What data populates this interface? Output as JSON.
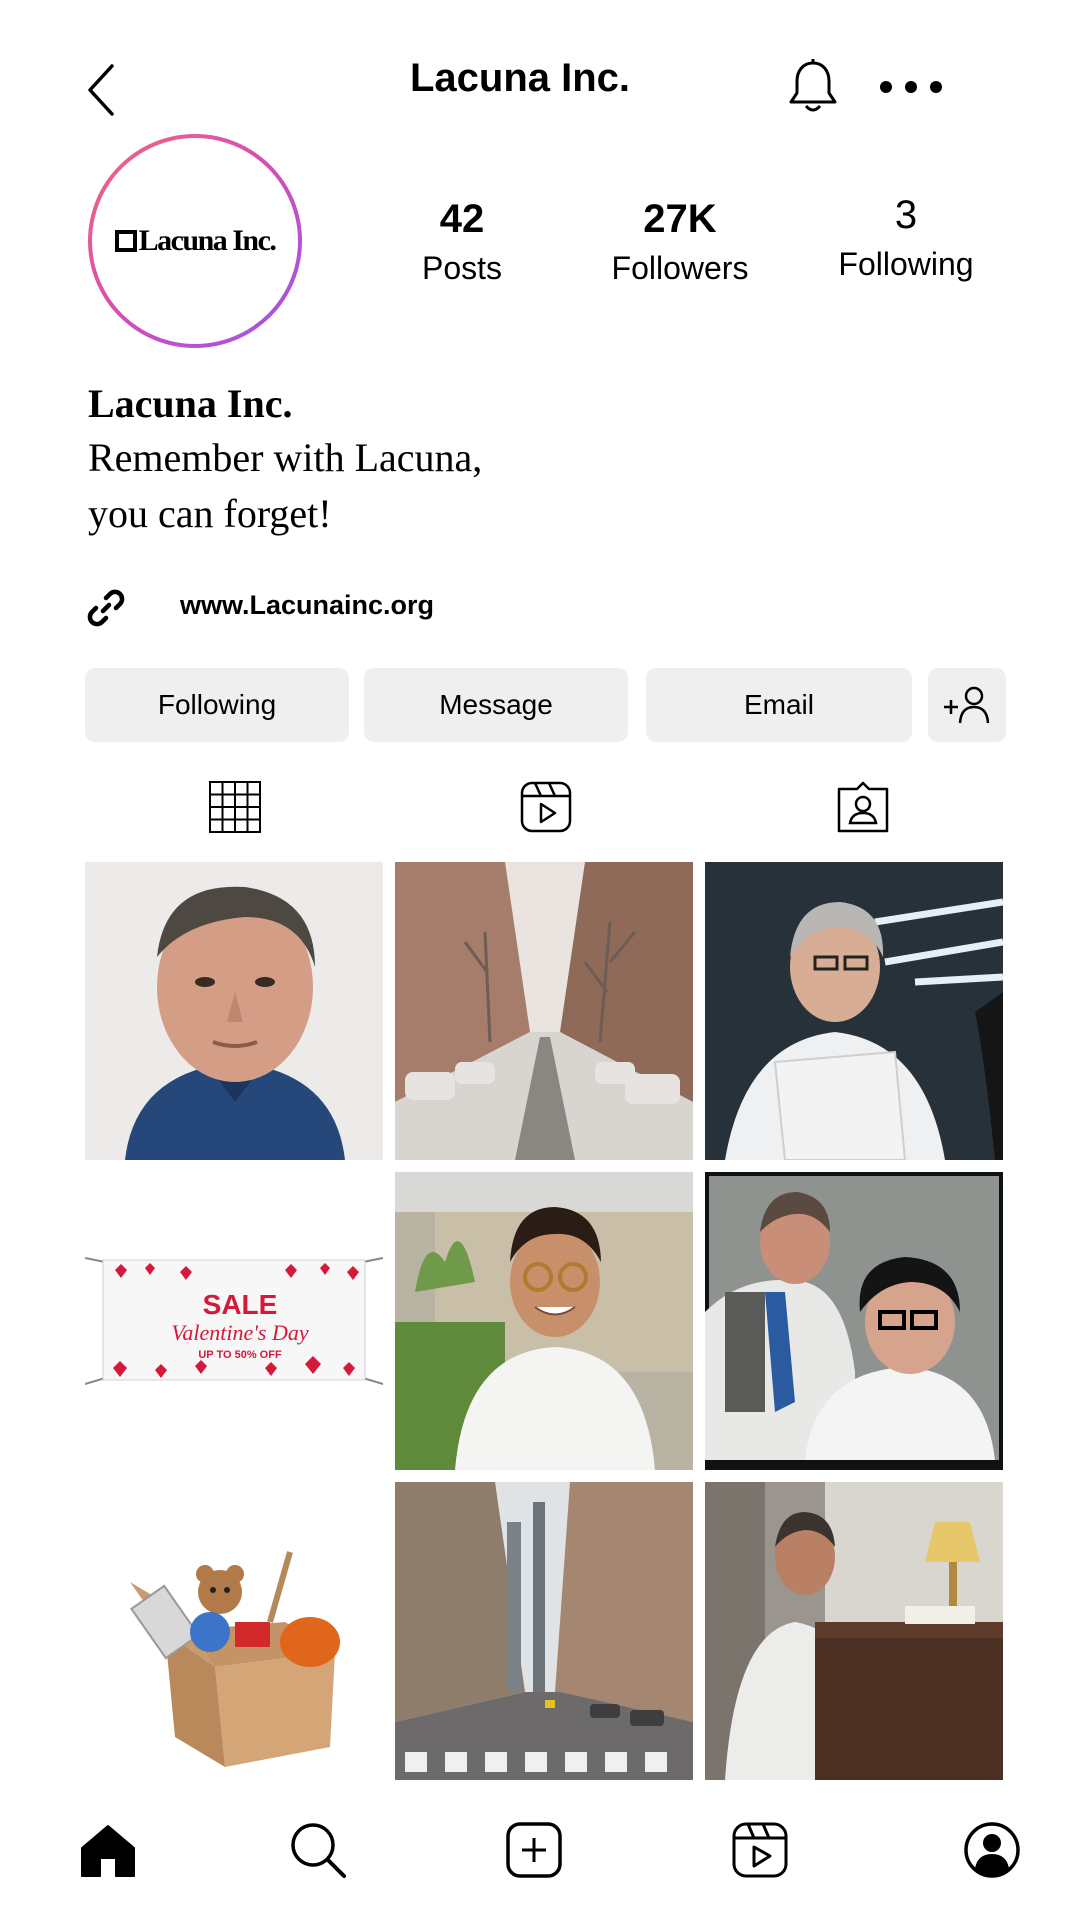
{
  "header": {
    "title": "Lacuna Inc."
  },
  "profile": {
    "avatar_text": "Lacuna Inc.",
    "stats": [
      {
        "value": "42",
        "label": "Posts"
      },
      {
        "value": "27K",
        "label": "Followers"
      },
      {
        "value": "3",
        "label": "Following"
      }
    ],
    "bio_name": "Lacuna Inc.",
    "bio_lines": [
      "Remember with Lacuna,",
      "you can forget!"
    ],
    "website": "www.Lacunainc.org"
  },
  "actions": {
    "following": "Following",
    "message": "Message",
    "email": "Email"
  },
  "grid": {
    "banner": {
      "sale": "SALE",
      "title": "Valentine's Day",
      "sub": "UP TO 50% OFF"
    }
  },
  "colors": {
    "accent_gradient_start": "#f4657a",
    "accent_gradient_end": "#9a55f0",
    "button_bg": "#efefef",
    "banner_red": "#d4193a"
  },
  "icons": [
    "back-icon",
    "bell-icon",
    "more-icon",
    "link-icon",
    "add-person-icon",
    "grid-icon",
    "reels-icon",
    "tagged-icon",
    "home-icon",
    "search-icon",
    "create-icon",
    "reels-nav-icon",
    "profile-icon"
  ]
}
